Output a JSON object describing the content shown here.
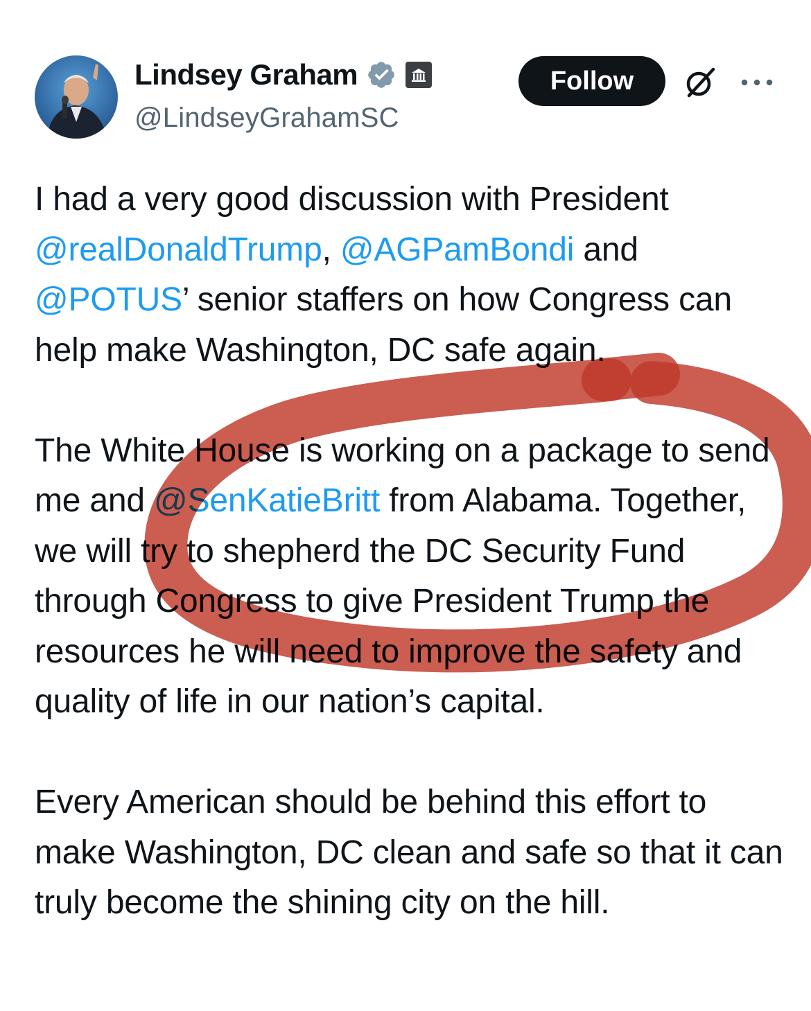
{
  "author": {
    "name": "Lindsey Graham",
    "handle": "@LindseyGrahamSC",
    "verified_icon": "verified-badge-icon",
    "affiliation_icon": "government-building-icon"
  },
  "actions": {
    "follow_label": "Follow",
    "grok_icon": "grok-icon",
    "more_icon": "more-options-icon"
  },
  "tweet": {
    "p1_a": "I had a very good discussion with President ",
    "mention1": "@realDonaldTrump",
    "p1_b": ", ",
    "mention2": "@AGPamBondi",
    "p1_c": " and ",
    "mention3": "@POTUS",
    "p1_d": "’ senior staffers on how Congress can help make Washington, DC safe again.",
    "p2_a": "The White House is working on a package to send me and ",
    "mention4": "@SenKatieBritt",
    "p2_b": " from Alabama. Together, we will try to shepherd the DC Security Fund through Congress to give President Trump the resources he will need to improve the safety and quality of life in our nation’s capital.",
    "p3": "Every American should be behind this effort to make Washington, DC clean and safe so that it can truly become the shining city on the hill."
  },
  "colors": {
    "mention": "#1d9bf0",
    "text": "#0f1419",
    "secondary": "#536471",
    "verified": "#829aab",
    "annotation": "#c0392b"
  }
}
